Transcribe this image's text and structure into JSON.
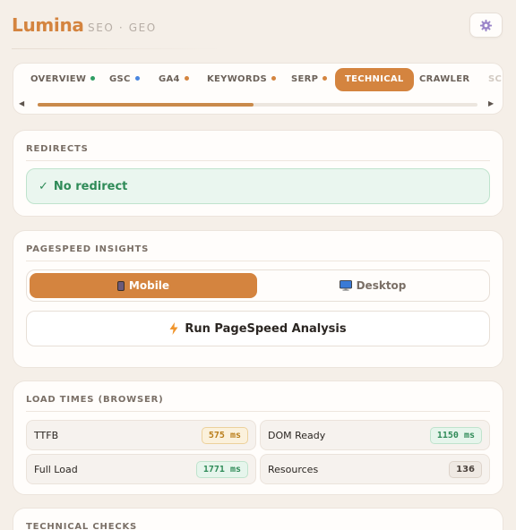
{
  "app": {
    "brand": "Lumina",
    "subtitle": "SEO · GEO"
  },
  "tabs": [
    {
      "label": "OVERVIEW",
      "dot_color": "#2f9e63"
    },
    {
      "label": "GSC",
      "dot_color": "#4a86e0"
    },
    {
      "label": "GA4",
      "dot_color": "#d4843f"
    },
    {
      "label": "KEYWORDS",
      "dot_color": "#d4843f"
    },
    {
      "label": "SERP",
      "dot_color": "#d4843f"
    },
    {
      "label": "TECHNICAL",
      "active": true
    },
    {
      "label": "CRAWLER"
    },
    {
      "label": "SC"
    }
  ],
  "tab_scroll": {
    "left_arrow": "◀",
    "right_arrow": "▶",
    "thumb_fraction": 0.49
  },
  "redirects": {
    "title": "REDIRECTS",
    "status_icon": "✓",
    "status": "No redirect"
  },
  "pagespeed": {
    "title": "PAGESPEED INSIGHTS",
    "mobile_label": "Mobile",
    "desktop_label": "Desktop",
    "selected": "Mobile",
    "run_label": "Run PageSpeed Analysis"
  },
  "load_times": {
    "title": "LOAD TIMES (BROWSER)",
    "metrics": [
      {
        "label": "TTFB",
        "value": "575 ms",
        "status": "amber"
      },
      {
        "label": "DOM Ready",
        "value": "1150 ms",
        "status": "green"
      },
      {
        "label": "Full Load",
        "value": "1771 ms",
        "status": "green"
      },
      {
        "label": "Resources",
        "value": "136",
        "status": "neutral"
      }
    ]
  },
  "technical_checks": {
    "title": "TECHNICAL CHECKS"
  },
  "colors": {
    "accent": "#d4843f",
    "success": "#2f8b58",
    "warning": "#b97d19"
  },
  "icons": {
    "settings": "gear-icon",
    "redirect_status": "check-icon",
    "mobile": "mobile-phone-icon",
    "desktop": "desktop-monitor-icon",
    "run": "lightning-bolt-icon"
  }
}
